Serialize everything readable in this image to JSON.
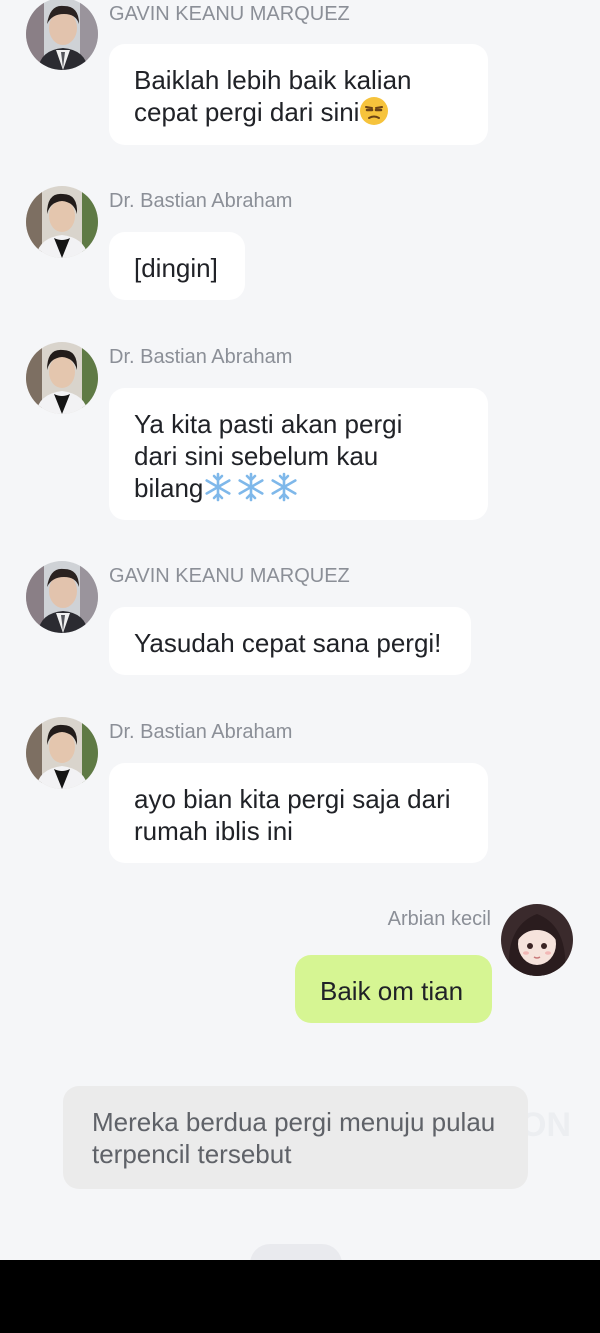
{
  "messages": [
    {
      "sender": "GAVIN KEANU MARQUEZ",
      "text": "Baiklah lebih baik kalian cepat pergi dari sini",
      "emoji": "unamused-face-emoji",
      "side": "left"
    },
    {
      "sender": "Dr. Bastian Abraham",
      "text": "[dingin]",
      "side": "left"
    },
    {
      "sender": "Dr. Bastian Abraham",
      "text": "Ya kita pasti akan pergi dari sini sebelum kau bilang",
      "emoji": "snowflake-emoji x3",
      "side": "left"
    },
    {
      "sender": "GAVIN KEANU MARQUEZ",
      "text": "Yasudah cepat sana pergi!",
      "side": "left"
    },
    {
      "sender": "Dr. Bastian Abraham",
      "text": "ayo bian kita pergi saja dari rumah iblis ini",
      "side": "left"
    },
    {
      "sender": "Arbian kecil",
      "text": "Baik om tian",
      "side": "right"
    }
  ],
  "narration": "Mereka berdua pergi menuju pulau terpencil tersebut",
  "watermark": "ON",
  "colors": {
    "background": "#f5f6f8",
    "bubble": "#ffffff",
    "my_bubble": "#d6f593",
    "narration_bubble": "#ebebeb",
    "name_text": "#8b8f97",
    "nav_bar": "#000000"
  }
}
